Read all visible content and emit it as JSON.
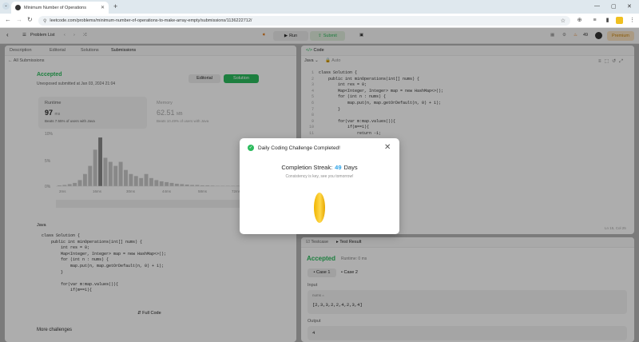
{
  "browser": {
    "tab_title": "Minimum Number of Operations",
    "url": "leetcode.com/problems/minimum-number-of-operations-to-make-array-empty/submissions/1136222712/"
  },
  "toolbar": {
    "problem_list": "Problem List",
    "run": "Run",
    "submit": "Submit",
    "streak_count": "49",
    "premium": "Premium"
  },
  "left": {
    "tabs": [
      "Description",
      "Editorial",
      "Solutions",
      "Submissions"
    ],
    "all_submissions": "All Submissions",
    "status": "Accepted",
    "submitted": "Unexposed submitted at Jan 03, 2024 21:04",
    "editorial_btn": "Editorial",
    "solution_btn": "Solution",
    "runtime_label": "Runtime",
    "runtime_value": "97",
    "runtime_unit": "ms",
    "runtime_beats": "Beats 7.55% of users with Java",
    "memory_label": "Memory",
    "memory_value": "62.51",
    "memory_unit": "MB",
    "memory_beats": "Beats 10.49% of users with Java",
    "y_ticks": [
      "10%",
      "5%",
      "0%"
    ],
    "x_ticks": [
      "2ms",
      "16ms",
      "30ms",
      "44ms",
      "58ms",
      "72ms"
    ],
    "lang": "Java",
    "full_code": "Full Code",
    "more": "More challenges",
    "code_lines": [
      "class Solution {",
      "    public int minOperations(int[] nums) {",
      "        int res = 0;",
      "        Map<Integer, Integer> map = new HashMap<>();",
      "        for (int n : nums) {",
      "            map.put(n, map.getOrDefault(n, 0) + 1);",
      "        }",
      "",
      "        for(var m:map.values()){",
      "            if(m==1){"
    ]
  },
  "code_panel": {
    "title": "Code",
    "lang": "Java",
    "auto": "Auto",
    "lines": [
      "class Solution {",
      "    public int minOperations(int[] nums) {",
      "        int res = 0;",
      "        Map<Integer, Integer> map = new HashMap<>();",
      "        for (int n : nums) {",
      "            map.put(n, map.getOrDefault(n, 0) + 1);",
      "        }",
      "",
      "        for(var m:map.values()){",
      "            if(m==1){",
      "                return -1;"
    ],
    "position": "Ln 15, Col 25"
  },
  "result_panel": {
    "tab_testcase": "Testcase",
    "tab_result": "Test Result",
    "status": "Accepted",
    "runtime": "Runtime: 0 ms",
    "case1": "Case 1",
    "case2": "Case 2",
    "input_label": "Input",
    "var_name": "nums =",
    "input_value": "[2,3,3,2,2,4,2,3,4]",
    "output_label": "Output",
    "output_value": "4"
  },
  "modal": {
    "title": "Daily Coding Challenge Completed!",
    "streak_label": "Completion Streak:",
    "streak_number": "49",
    "streak_unit": "Days",
    "subtitle": "Consistency is key, see you tomorrow!"
  },
  "colors": {
    "accent_green": "#2cbb5d",
    "streak_blue": "#2ba2e8",
    "coin_gold": "#f5c518"
  },
  "chart_data": {
    "type": "bar",
    "xlabel": "",
    "ylabel": "",
    "x": [
      "2ms",
      "4ms",
      "6ms",
      "8ms",
      "10ms",
      "12ms",
      "14ms",
      "16ms",
      "18ms",
      "20ms",
      "22ms",
      "24ms",
      "26ms",
      "28ms",
      "30ms",
      "32ms",
      "34ms",
      "36ms",
      "38ms",
      "40ms",
      "42ms",
      "44ms",
      "46ms",
      "48ms",
      "50ms",
      "52ms",
      "54ms",
      "56ms",
      "58ms",
      "60ms",
      "62ms",
      "64ms",
      "66ms",
      "68ms",
      "70ms",
      "72ms"
    ],
    "values": [
      0.2,
      0.3,
      0.5,
      0.8,
      1.5,
      3,
      5,
      9,
      12,
      7,
      6,
      5,
      6,
      4,
      3,
      2.5,
      2,
      3,
      2,
      1.5,
      1.2,
      1,
      0.8,
      0.6,
      0.5,
      0.4,
      0.3,
      0.3,
      0.2,
      0.2,
      0.15,
      0.1,
      0.1,
      0.1,
      0.1,
      0.1
    ],
    "ylim": [
      0,
      13
    ]
  }
}
